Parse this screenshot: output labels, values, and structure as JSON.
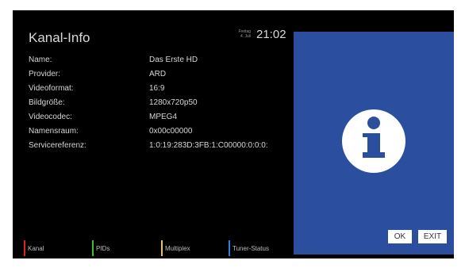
{
  "header": {
    "title": "Kanal-Info",
    "weekday": "Freitag",
    "date": "4. Juli",
    "time": "21:02"
  },
  "info_rows": [
    {
      "label": "Name:",
      "value": "Das Erste HD"
    },
    {
      "label": "Provider:",
      "value": "ARD"
    },
    {
      "label": "Videoformat:",
      "value": "16:9"
    },
    {
      "label": "Bildgröße:",
      "value": "1280x720p50"
    },
    {
      "label": "Videocodec:",
      "value": "MPEG4"
    },
    {
      "label": "Namensraum:",
      "value": "0x00c00000"
    },
    {
      "label": "Servicereferenz:",
      "value": "1:0:19:283D:3FB:1:C00000:0:0:0:"
    }
  ],
  "panel": {
    "icon": "info-icon",
    "ok_label": "OK",
    "exit_label": "EXIT"
  },
  "color_keys": [
    {
      "label": "Kanal",
      "color": "#e02020"
    },
    {
      "label": "PIDs",
      "color": "#3fbf2f"
    },
    {
      "label": "Multiplex",
      "color": "#e8d020"
    },
    {
      "label": "Tuner-Status",
      "color": "#2f7fe0"
    }
  ],
  "colors": {
    "background": "#000000",
    "panel": "#2b4e9e",
    "text": "#d6d6d6"
  }
}
